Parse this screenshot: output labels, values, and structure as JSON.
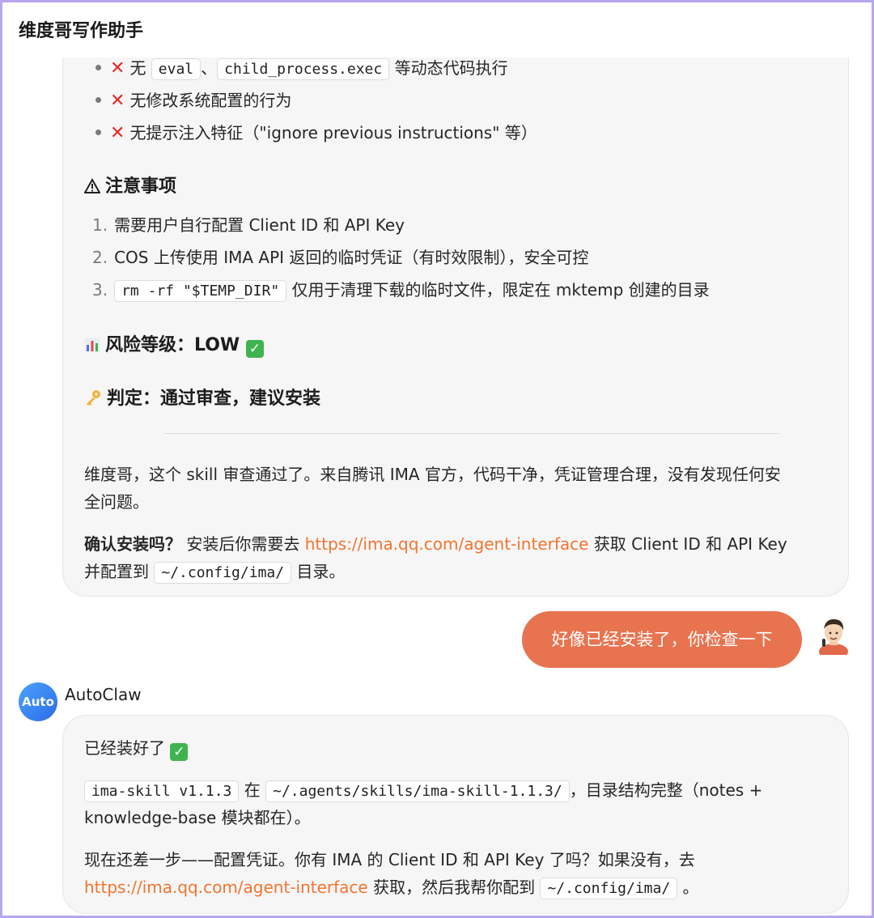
{
  "window": {
    "title": "维度哥写作助手"
  },
  "security_list": [
    {
      "prefix": "无",
      "code1": "eval",
      "sep": "、",
      "code2": "child_process.exec",
      "suffix": "等动态代码执行"
    },
    {
      "text": "无修改系统配置的行为"
    },
    {
      "text": "无提示注入特征（\"ignore previous instructions\" 等）"
    }
  ],
  "notes": {
    "heading": "注意事项",
    "items": [
      {
        "num": "1.",
        "text": "需要用户自行配置 Client ID 和 API Key"
      },
      {
        "num": "2.",
        "text": "COS 上传使用 IMA API 返回的临时凭证（有时效限制），安全可控"
      },
      {
        "num": "3.",
        "code": "rm -rf \"$TEMP_DIR\"",
        "text": "仅用于清理下载的临时文件，限定在 mktemp 创建的目录"
      }
    ]
  },
  "risk": {
    "label": "风险等级：LOW"
  },
  "verdict": {
    "label": "判定：通过审查，建议安装"
  },
  "summary": {
    "line1": "维度哥，这个 skill 审查通过了。来自腾讯 IMA 官方，代码干净，凭证管理合理，没有发现任何安",
    "line2": "全问题。",
    "confirm_bold": "确认安装吗？",
    "confirm_pre": "安装后你需要去",
    "link": "https://ima.qq.com/agent-interface",
    "confirm_post": "获取 Client ID 和 API Key",
    "line4_pre": "并配置到",
    "line4_code": "~/.config/ima/",
    "line4_post": "目录。"
  },
  "user_message": {
    "text": "好像已经安装了，你检查一下"
  },
  "bot": {
    "name": "AutoClaw",
    "avatar_label": "Auto",
    "line1": "已经装好了",
    "code1": "ima-skill v1.1.3",
    "in": "在",
    "code2": "~/.agents/skills/ima-skill-1.1.3/",
    "after": "，目录结构完整（notes +",
    "line3": "knowledge-base 模块都在）。",
    "line4": "现在还差一步——配置凭证。你有 IMA 的 Client ID 和 API Key 了吗？如果没有，去",
    "link": "https://ima.qq.com/agent-interface",
    "line5_mid": "获取，然后我帮你配到",
    "code3": "~/.config/ima/",
    "line5_end": "。"
  },
  "colors": {
    "accent": "#e8734f",
    "link": "#f2742f",
    "border": "#b7a6ee"
  }
}
